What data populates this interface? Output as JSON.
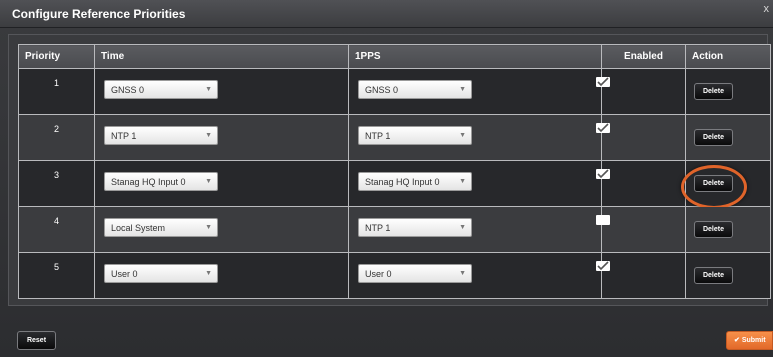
{
  "dialog": {
    "title": "Configure Reference Priorities",
    "close_glyph": "x"
  },
  "table": {
    "headers": {
      "priority": "Priority",
      "time": "Time",
      "pps": "1PPS",
      "enabled": "Enabled",
      "action": "Action"
    },
    "rows": [
      {
        "priority": "1",
        "time": "GNSS 0",
        "pps": "GNSS 0",
        "enabled": true,
        "action": "Delete"
      },
      {
        "priority": "2",
        "time": "NTP 1",
        "pps": "NTP 1",
        "enabled": true,
        "action": "Delete"
      },
      {
        "priority": "3",
        "time": "Stanag HQ Input 0",
        "pps": "Stanag HQ Input 0",
        "enabled": true,
        "action": "Delete",
        "highlighted": true
      },
      {
        "priority": "4",
        "time": "Local System",
        "pps": "NTP 1",
        "enabled": false,
        "action": "Delete"
      },
      {
        "priority": "5",
        "time": "User 0",
        "pps": "User 0",
        "enabled": true,
        "action": "Delete"
      }
    ]
  },
  "footer": {
    "reset_label": "Reset",
    "submit_label": "Submit",
    "submit_icon": "check-icon"
  },
  "colors": {
    "accent": "#f0803e",
    "highlight_ring": "#e0642a"
  }
}
